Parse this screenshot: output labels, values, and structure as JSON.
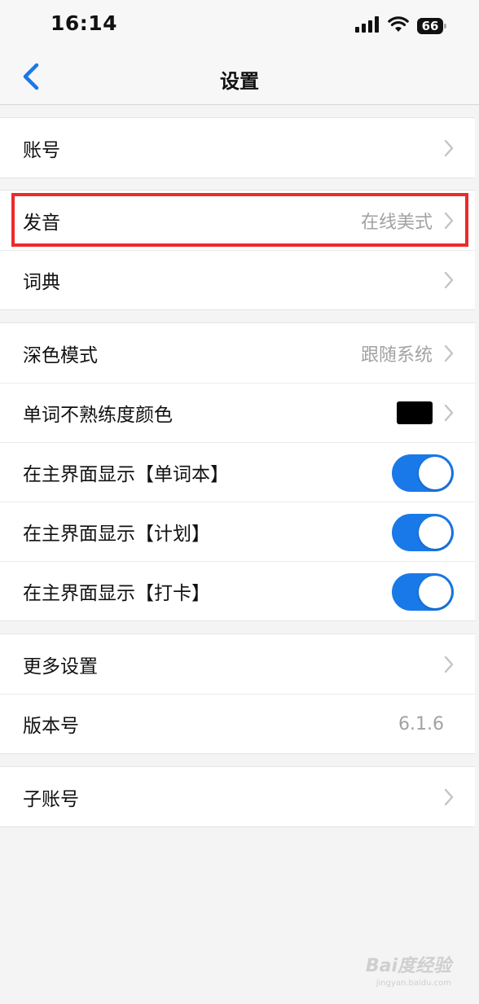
{
  "status_bar": {
    "time": "16:14",
    "battery": "66"
  },
  "nav": {
    "title": "设置"
  },
  "groups": [
    {
      "rows": [
        {
          "label": "账号"
        }
      ]
    },
    {
      "rows": [
        {
          "label": "发音",
          "value": "在线美式"
        },
        {
          "label": "词典"
        }
      ]
    },
    {
      "rows": [
        {
          "label": "深色模式",
          "value": "跟随系统"
        },
        {
          "label": "单词不熟练度颜色",
          "swatch_color": "#000000"
        },
        {
          "label": "在主界面显示【单词本】",
          "toggle_on": true
        },
        {
          "label": "在主界面显示【计划】",
          "toggle_on": true
        },
        {
          "label": "在主界面显示【打卡】",
          "toggle_on": true
        }
      ]
    },
    {
      "rows": [
        {
          "label": "更多设置"
        },
        {
          "label": "版本号",
          "value": "6.1.6"
        }
      ]
    },
    {
      "rows": [
        {
          "label": "子账号"
        }
      ]
    }
  ],
  "colors": {
    "accent": "#1a79e8",
    "highlight": "#ee2a2a"
  },
  "watermark": {
    "logo": "Bai度经验",
    "url": "jingyan.baidu.com"
  },
  "icons": {
    "back": "chevron-left-icon",
    "row_arrow": "chevron-right-icon",
    "signal": "cellular-signal-icon",
    "wifi": "wifi-icon",
    "battery": "battery-icon"
  }
}
